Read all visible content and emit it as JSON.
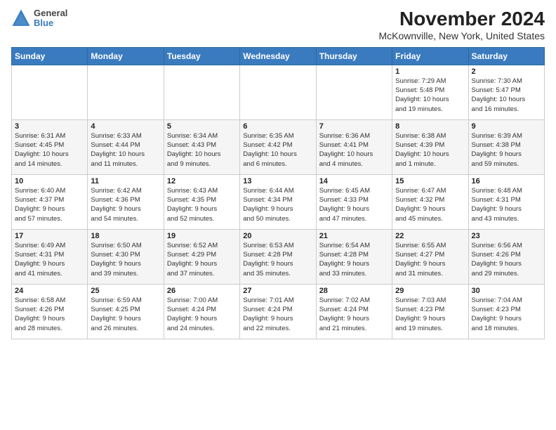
{
  "logo": {
    "general": "General",
    "blue": "Blue"
  },
  "title": "November 2024",
  "location": "McKownville, New York, United States",
  "headers": [
    "Sunday",
    "Monday",
    "Tuesday",
    "Wednesday",
    "Thursday",
    "Friday",
    "Saturday"
  ],
  "weeks": [
    [
      {
        "day": "",
        "info": ""
      },
      {
        "day": "",
        "info": ""
      },
      {
        "day": "",
        "info": ""
      },
      {
        "day": "",
        "info": ""
      },
      {
        "day": "",
        "info": ""
      },
      {
        "day": "1",
        "info": "Sunrise: 7:29 AM\nSunset: 5:48 PM\nDaylight: 10 hours\nand 19 minutes."
      },
      {
        "day": "2",
        "info": "Sunrise: 7:30 AM\nSunset: 5:47 PM\nDaylight: 10 hours\nand 16 minutes."
      }
    ],
    [
      {
        "day": "3",
        "info": "Sunrise: 6:31 AM\nSunset: 4:45 PM\nDaylight: 10 hours\nand 14 minutes."
      },
      {
        "day": "4",
        "info": "Sunrise: 6:33 AM\nSunset: 4:44 PM\nDaylight: 10 hours\nand 11 minutes."
      },
      {
        "day": "5",
        "info": "Sunrise: 6:34 AM\nSunset: 4:43 PM\nDaylight: 10 hours\nand 9 minutes."
      },
      {
        "day": "6",
        "info": "Sunrise: 6:35 AM\nSunset: 4:42 PM\nDaylight: 10 hours\nand 6 minutes."
      },
      {
        "day": "7",
        "info": "Sunrise: 6:36 AM\nSunset: 4:41 PM\nDaylight: 10 hours\nand 4 minutes."
      },
      {
        "day": "8",
        "info": "Sunrise: 6:38 AM\nSunset: 4:39 PM\nDaylight: 10 hours\nand 1 minute."
      },
      {
        "day": "9",
        "info": "Sunrise: 6:39 AM\nSunset: 4:38 PM\nDaylight: 9 hours\nand 59 minutes."
      }
    ],
    [
      {
        "day": "10",
        "info": "Sunrise: 6:40 AM\nSunset: 4:37 PM\nDaylight: 9 hours\nand 57 minutes."
      },
      {
        "day": "11",
        "info": "Sunrise: 6:42 AM\nSunset: 4:36 PM\nDaylight: 9 hours\nand 54 minutes."
      },
      {
        "day": "12",
        "info": "Sunrise: 6:43 AM\nSunset: 4:35 PM\nDaylight: 9 hours\nand 52 minutes."
      },
      {
        "day": "13",
        "info": "Sunrise: 6:44 AM\nSunset: 4:34 PM\nDaylight: 9 hours\nand 50 minutes."
      },
      {
        "day": "14",
        "info": "Sunrise: 6:45 AM\nSunset: 4:33 PM\nDaylight: 9 hours\nand 47 minutes."
      },
      {
        "day": "15",
        "info": "Sunrise: 6:47 AM\nSunset: 4:32 PM\nDaylight: 9 hours\nand 45 minutes."
      },
      {
        "day": "16",
        "info": "Sunrise: 6:48 AM\nSunset: 4:31 PM\nDaylight: 9 hours\nand 43 minutes."
      }
    ],
    [
      {
        "day": "17",
        "info": "Sunrise: 6:49 AM\nSunset: 4:31 PM\nDaylight: 9 hours\nand 41 minutes."
      },
      {
        "day": "18",
        "info": "Sunrise: 6:50 AM\nSunset: 4:30 PM\nDaylight: 9 hours\nand 39 minutes."
      },
      {
        "day": "19",
        "info": "Sunrise: 6:52 AM\nSunset: 4:29 PM\nDaylight: 9 hours\nand 37 minutes."
      },
      {
        "day": "20",
        "info": "Sunrise: 6:53 AM\nSunset: 4:28 PM\nDaylight: 9 hours\nand 35 minutes."
      },
      {
        "day": "21",
        "info": "Sunrise: 6:54 AM\nSunset: 4:28 PM\nDaylight: 9 hours\nand 33 minutes."
      },
      {
        "day": "22",
        "info": "Sunrise: 6:55 AM\nSunset: 4:27 PM\nDaylight: 9 hours\nand 31 minutes."
      },
      {
        "day": "23",
        "info": "Sunrise: 6:56 AM\nSunset: 4:26 PM\nDaylight: 9 hours\nand 29 minutes."
      }
    ],
    [
      {
        "day": "24",
        "info": "Sunrise: 6:58 AM\nSunset: 4:26 PM\nDaylight: 9 hours\nand 28 minutes."
      },
      {
        "day": "25",
        "info": "Sunrise: 6:59 AM\nSunset: 4:25 PM\nDaylight: 9 hours\nand 26 minutes."
      },
      {
        "day": "26",
        "info": "Sunrise: 7:00 AM\nSunset: 4:24 PM\nDaylight: 9 hours\nand 24 minutes."
      },
      {
        "day": "27",
        "info": "Sunrise: 7:01 AM\nSunset: 4:24 PM\nDaylight: 9 hours\nand 22 minutes."
      },
      {
        "day": "28",
        "info": "Sunrise: 7:02 AM\nSunset: 4:24 PM\nDaylight: 9 hours\nand 21 minutes."
      },
      {
        "day": "29",
        "info": "Sunrise: 7:03 AM\nSunset: 4:23 PM\nDaylight: 9 hours\nand 19 minutes."
      },
      {
        "day": "30",
        "info": "Sunrise: 7:04 AM\nSunset: 4:23 PM\nDaylight: 9 hours\nand 18 minutes."
      }
    ]
  ]
}
